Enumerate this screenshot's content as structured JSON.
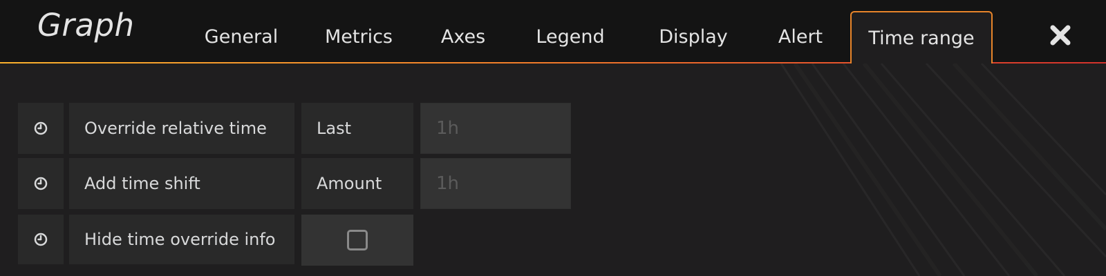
{
  "panel": {
    "title": "Graph",
    "close_icon": "close-icon"
  },
  "tabs": [
    {
      "label": "General",
      "active": false
    },
    {
      "label": "Metrics",
      "active": false
    },
    {
      "label": "Axes",
      "active": false
    },
    {
      "label": "Legend",
      "active": false
    },
    {
      "label": "Display",
      "active": false
    },
    {
      "label": "Alert",
      "active": false
    },
    {
      "label": "Time range",
      "active": true
    }
  ],
  "time_range": {
    "override_relative_time": {
      "icon": "clock-icon",
      "label": "Override relative time",
      "sub_label": "Last",
      "value": "",
      "placeholder": "1h"
    },
    "add_time_shift": {
      "icon": "clock-icon",
      "label": "Add time shift",
      "sub_label": "Amount",
      "value": "",
      "placeholder": "1h"
    },
    "hide_time_override_info": {
      "icon": "clock-icon",
      "label": "Hide time override info",
      "checked": false
    }
  },
  "colors": {
    "accent_start": "#fbb12d",
    "accent_end": "#d4322c",
    "active_tab_border": "#e8852a",
    "background": "#1f1e1f",
    "header_background": "#141414"
  }
}
